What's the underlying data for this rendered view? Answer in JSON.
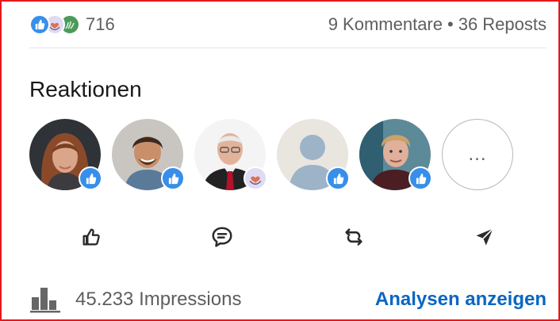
{
  "summary": {
    "reaction_icons": [
      "like-icon",
      "love-icon",
      "support-icon"
    ],
    "reaction_count": "716",
    "comments": "9 Kommentare",
    "separator": "•",
    "reposts": "36 Reposts"
  },
  "reactions_section": {
    "title": "Reaktionen",
    "reactors": [
      {
        "reaction": "like"
      },
      {
        "reaction": "like"
      },
      {
        "reaction": "love"
      },
      {
        "reaction": "like"
      },
      {
        "reaction": "like"
      }
    ],
    "more_label": "..."
  },
  "actions": [
    {
      "icon": "thumbs-up-icon"
    },
    {
      "icon": "comment-icon"
    },
    {
      "icon": "repost-icon"
    },
    {
      "icon": "send-icon"
    }
  ],
  "impressions": {
    "icon": "bar-chart-icon",
    "text": "45.233 Impressions",
    "link_label": "Analysen anzeigen"
  },
  "colors": {
    "accent_blue": "#0a66c2",
    "like_blue": "#378fe9",
    "frame_red": "#e8161b",
    "muted_text": "#5e5e5e"
  }
}
